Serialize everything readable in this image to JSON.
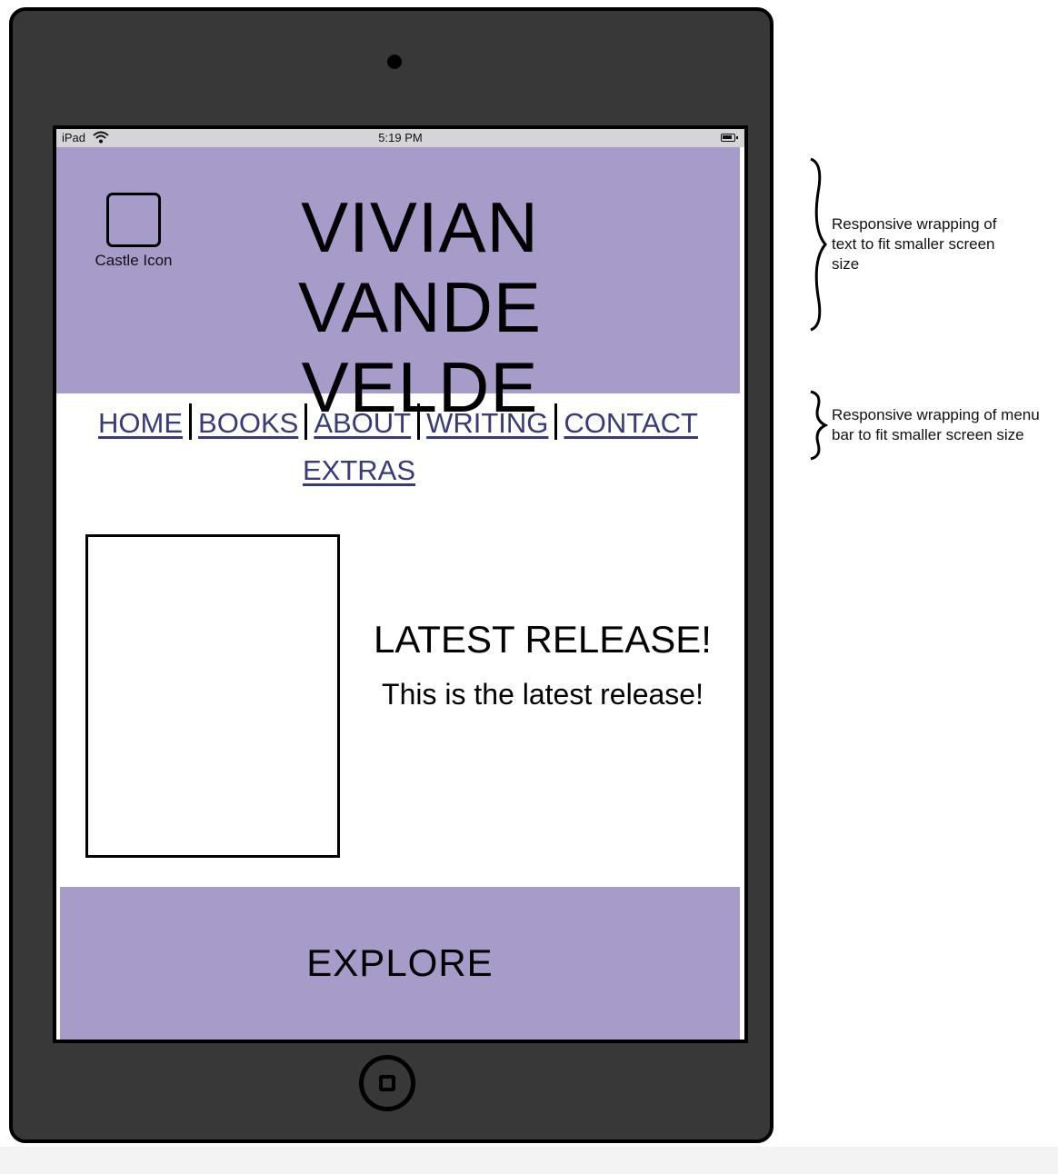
{
  "status_bar": {
    "device": "iPad",
    "time": "5:19 PM"
  },
  "header": {
    "castle_label": "Castle Icon",
    "title": "VIVIAN VANDE VELDE"
  },
  "nav": {
    "items": [
      {
        "label": "HOME"
      },
      {
        "label": "BOOKS"
      },
      {
        "label": "ABOUT"
      },
      {
        "label": "WRITING"
      },
      {
        "label": "CONTACT"
      },
      {
        "label": "EXTRAS"
      }
    ]
  },
  "release": {
    "heading": "LATEST RELEASE!",
    "text": "This is the latest release!"
  },
  "explore": {
    "label": "EXPLORE"
  },
  "annotations": {
    "title_note": "Responsive wrapping of text to fit smaller screen size",
    "menu_note": "Responsive wrapping of menu bar to fit smaller screen size"
  },
  "colors": {
    "header_bg": "#a79cc9",
    "device_frame": "#383838",
    "link": "#3a3a7a"
  }
}
